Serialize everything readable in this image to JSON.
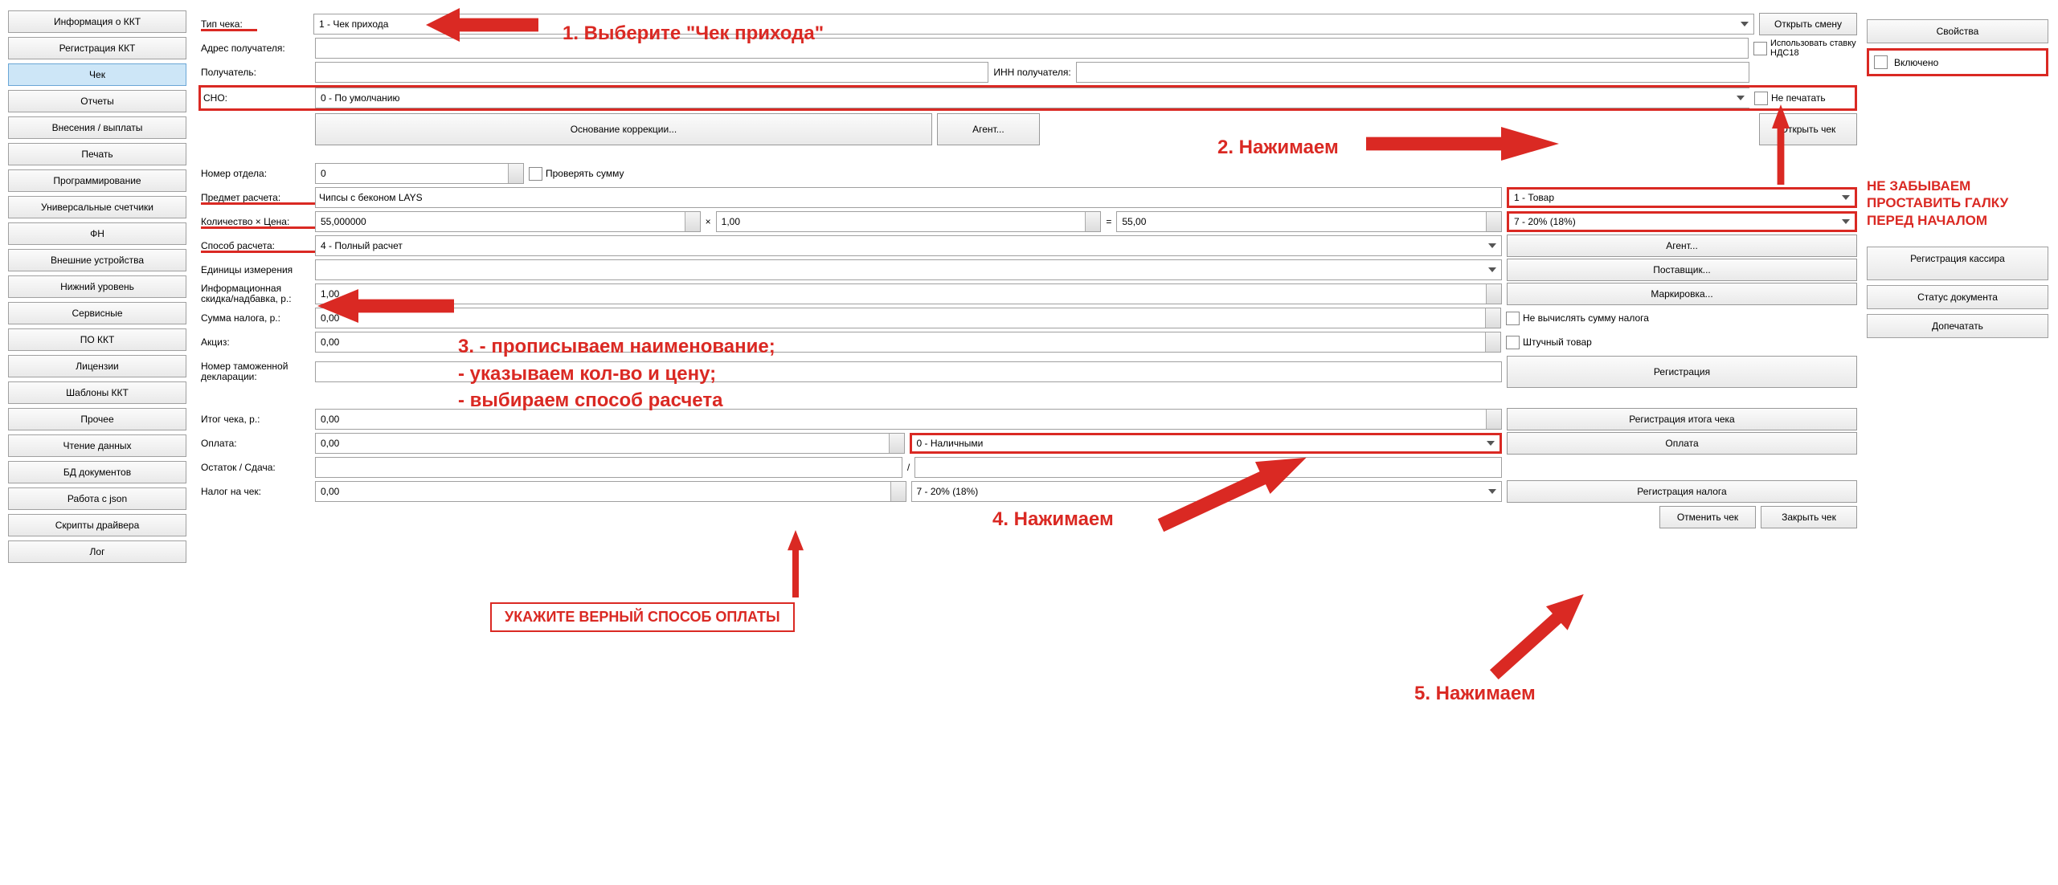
{
  "nav": [
    "Информация о ККТ",
    "Регистрация ККТ",
    "Чек",
    "Отчеты",
    "Внесения / выплаты",
    "Печать",
    "Программирование",
    "Универсальные счетчики",
    "ФН",
    "Внешние устройства",
    "Нижний уровень",
    "Сервисные",
    "ПО ККТ",
    "Лицензии",
    "Шаблоны ККТ",
    "Прочее",
    "Чтение данных",
    "БД документов",
    "Работа с json",
    "Скрипты драйвера",
    "Лог"
  ],
  "nav_sel": 2,
  "right": {
    "properties": "Свойства",
    "enabled": "Включено",
    "reg_cashier": "Регистрация кассира",
    "doc_status": "Статус документа",
    "dopech": "Допечатать"
  },
  "top": {
    "receipt_type_lbl": "Тип чека:",
    "receipt_type_val": "1 - Чек прихода",
    "open_shift": "Открыть смену",
    "recipient_addr_lbl": "Адрес получателя:",
    "use_vat18": "Использовать ставку НДС18",
    "recipient_lbl": "Получатель:",
    "inn_lbl": "ИНН получателя:",
    "sno_lbl": "СНО:",
    "sno_val": "0 - По умолчанию",
    "no_print": "Не печатать",
    "basis": "Основание коррекции...",
    "agent": "Агент...",
    "open_chk": "Открыть чек"
  },
  "mid": {
    "dept_lbl": "Номер отдела:",
    "dept_val": "0",
    "check_sum": "Проверять сумму",
    "subject_lbl": "Предмет расчета:",
    "subject_val": "Чипсы с беконом LAYS",
    "item_type": "1 - Товар",
    "qty_price_lbl": "Количество × Цена:",
    "qty_val": "55,000000",
    "x_lbl": "×",
    "price_val": "1,00",
    "eq": "=",
    "sum_val": "55,00",
    "vat": "7 - 20% (18%)",
    "method_lbl": "Способ расчета:",
    "method_val": "4 - Полный расчет",
    "agent_btn": "Агент...",
    "unit_lbl": "Единицы измерения",
    "supplier_btn": "Поставщик...",
    "discount_lbl": "Информационная скидка/надбавка, р.:",
    "discount_val": "1,00",
    "marking_btn": "Маркировка...",
    "taxsum_lbl": "Сумма налога, р.:",
    "taxsum_val": "0,00",
    "no_calc_tax": "Не вычислять сумму налога",
    "excise_lbl": "Акциз:",
    "excise_val": "0,00",
    "piece_goods": "Штучный товар",
    "customs_lbl": "Номер таможенной декларации:",
    "register": "Регистрация"
  },
  "bottom": {
    "total_lbl": "Итог чека, р.:",
    "total_val": "0,00",
    "reg_total": "Регистрация итога чека",
    "payment_lbl": "Оплата:",
    "payment_val": "0,00",
    "payment_type": "0 - Наличными",
    "pay_btn": "Оплата",
    "remainder_lbl": "Остаток / Сдача:",
    "slash": "/",
    "tax_on_chk_lbl": "Налог на чек:",
    "tax_on_chk_val": "0,00",
    "tax_type": "7 - 20% (18%)",
    "reg_tax": "Регистрация налога",
    "cancel_chk": "Отменить чек",
    "close_chk": "Закрыть чек"
  },
  "annot": {
    "a1": "1. Выберите \"Чек прихода\"",
    "a2": "2. Нажимаем",
    "a3_l1": "3. - прописываем наименование;",
    "a3_l2": "   - указываем кол-во и цену;",
    "a3_l3": "   - выбираем способ расчета",
    "a4": "4. Нажимаем",
    "a5": "5. Нажимаем",
    "pay_note": "УКАЖИТЕ ВЕРНЫЙ СПОСОБ ОПЛАТЫ",
    "remember": "НЕ ЗАБЫВАЕМ ПРОСТАВИТЬ ГАЛКУ ПЕРЕД НАЧАЛОМ"
  }
}
